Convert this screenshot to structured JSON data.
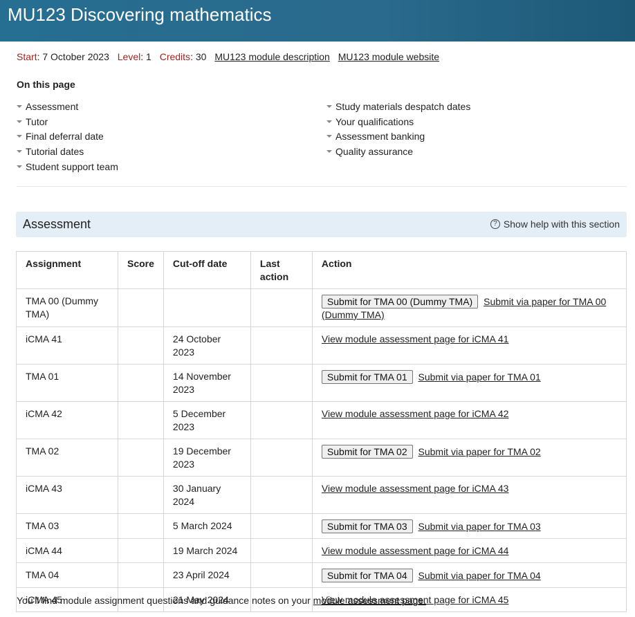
{
  "header": {
    "title": "MU123 Discovering mathematics"
  },
  "meta": {
    "start_label": "Start",
    "start_value": "7 October 2023",
    "level_label": "Level",
    "level_value": "1",
    "credits_label": "Credits",
    "credits_value": "30",
    "link_description": "MU123 module description",
    "link_website": "MU123 module website"
  },
  "on_this_page": {
    "title": "On this page",
    "left": [
      "Assessment",
      "Tutor",
      "Final deferral date",
      "Tutorial dates",
      "Student support team"
    ],
    "right": [
      "Study materials despatch dates",
      "Your qualifications",
      "Assessment banking",
      "Quality assurance"
    ]
  },
  "assessment": {
    "title": "Assessment",
    "help_label": "Show help with this section",
    "columns": [
      "Assignment",
      "Score",
      "Cut-off date",
      "Last action",
      "Action"
    ],
    "rows": [
      {
        "assignment": "TMA 00 (Dummy TMA)",
        "score": "",
        "cutoff": "",
        "last_action": "",
        "button": "Submit for TMA 00 (Dummy TMA)",
        "link": "Submit via paper for TMA 00 (Dummy TMA)"
      },
      {
        "assignment": "iCMA 41",
        "score": "",
        "cutoff": "24 October 2023",
        "last_action": "",
        "button": "",
        "link": "View module assessment page for iCMA 41"
      },
      {
        "assignment": "TMA 01",
        "score": "",
        "cutoff": "14 November 2023",
        "last_action": "",
        "button": "Submit for TMA 01",
        "link": "Submit via paper for TMA 01"
      },
      {
        "assignment": "iCMA 42",
        "score": "",
        "cutoff": "5 December 2023",
        "last_action": "",
        "button": "",
        "link": "View module assessment page for iCMA 42"
      },
      {
        "assignment": "TMA 02",
        "score": "",
        "cutoff": "19 December 2023",
        "last_action": "",
        "button": "Submit for TMA 02",
        "link": "Submit via paper for TMA 02"
      },
      {
        "assignment": "iCMA 43",
        "score": "",
        "cutoff": "30 January 2024",
        "last_action": "",
        "button": "",
        "link": "View module assessment page for iCMA 43"
      },
      {
        "assignment": "TMA 03",
        "score": "",
        "cutoff": "5 March 2024",
        "last_action": "",
        "button": "Submit for TMA 03",
        "link": "Submit via paper for TMA 03"
      },
      {
        "assignment": "iCMA 44",
        "score": "",
        "cutoff": "19 March 2024",
        "last_action": "",
        "button": "",
        "link": "View module assessment page for iCMA 44"
      },
      {
        "assignment": "TMA 04",
        "score": "",
        "cutoff": "23 April 2024",
        "last_action": "",
        "button": "Submit for TMA 04",
        "link": "Submit via paper for TMA 04"
      },
      {
        "assignment": "iCMA 45",
        "score": "",
        "cutoff": "21 May 2024",
        "last_action": "",
        "button": "",
        "link": "View module assessment page for iCMA 45"
      }
    ]
  },
  "footer": {
    "text": "You'll find module assignment questions and guidance notes on your ",
    "link": "module assessment page."
  }
}
